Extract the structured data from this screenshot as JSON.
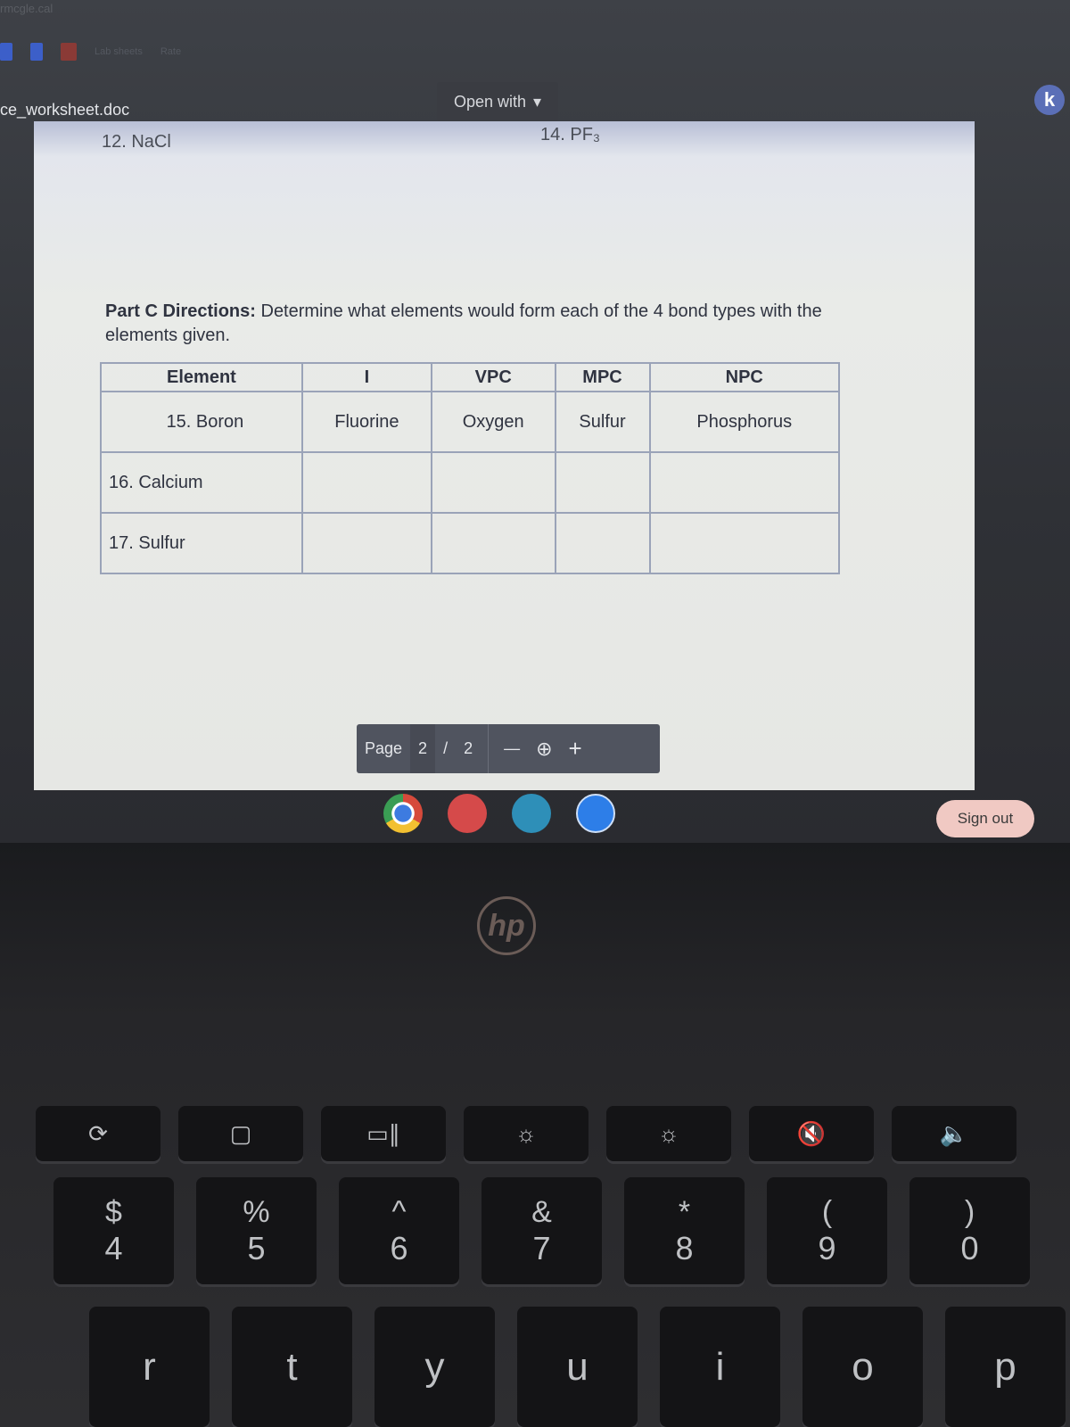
{
  "browser": {
    "top_text": "rmcgle.cal",
    "tabs": [
      "",
      "",
      "Lab sheets",
      "Rate"
    ]
  },
  "viewer": {
    "filename": "ce_worksheet.doc",
    "open_with": "Open with",
    "dropdown_icon": "caret-down-icon"
  },
  "document": {
    "q12": "12. NaCl",
    "q14": "14. PF₃",
    "directions_bold": "Part C Directions:",
    "directions": " Determine what elements would form each of the 4 bond types with the elements given.",
    "table": {
      "headers": [
        "Element",
        "I",
        "VPC",
        "MPC",
        "NPC"
      ],
      "rows": [
        [
          "15. Boron",
          "Fluorine",
          "Oxygen",
          "Sulfur",
          "Phosphorus"
        ],
        [
          "16. Calcium",
          "",
          "",
          "",
          ""
        ],
        [
          "17. Sulfur",
          "",
          "",
          "",
          ""
        ]
      ]
    }
  },
  "pagebar": {
    "label": "Page",
    "current": "2",
    "sep": "/",
    "total": "2",
    "zoom_out": "—",
    "zoom_icon": "zoom-icon",
    "zoom_in": "+"
  },
  "shelf": {
    "apps": [
      "chrome",
      "paint",
      "classroom",
      "zoom"
    ]
  },
  "signout": "Sign out",
  "account_badge": "k",
  "keyboard": {
    "logo": "hp",
    "fn_row": [
      "⟳",
      "▢",
      "▭∥",
      "☼",
      "☼",
      "🔇",
      "🔈"
    ],
    "num_row": [
      [
        "$",
        "4"
      ],
      [
        "%",
        "5"
      ],
      [
        "^",
        "6"
      ],
      [
        "&",
        "7"
      ],
      [
        "*",
        "8"
      ],
      [
        "(",
        "9"
      ],
      [
        ")",
        "0"
      ]
    ],
    "letter_row": [
      "r",
      "t",
      "y",
      "u",
      "i",
      "o",
      "p"
    ]
  }
}
